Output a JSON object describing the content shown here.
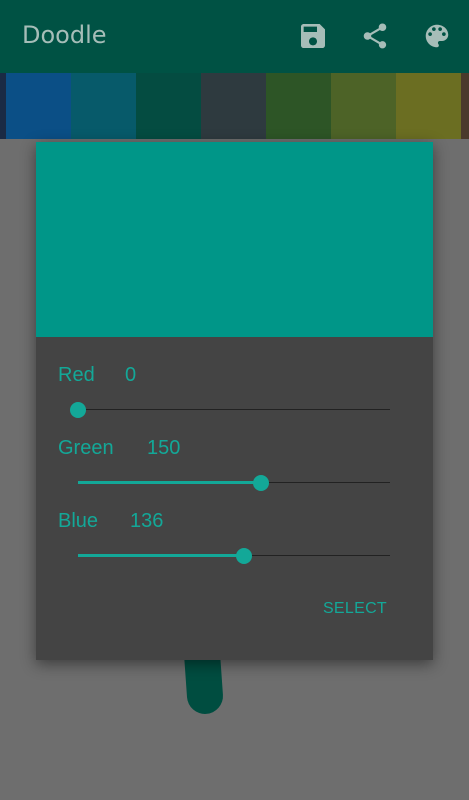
{
  "app": {
    "title": "Doodle",
    "actions": [
      {
        "name": "save-icon",
        "label": "Save"
      },
      {
        "name": "share-icon",
        "label": "Share"
      },
      {
        "name": "palette-icon",
        "label": "Palette"
      }
    ]
  },
  "palette": {
    "swatches": [
      "#0b4f86",
      "#075a6a",
      "#044c41",
      "#2e3a3f",
      "#2d5526",
      "#4d6327",
      "#6b6e22"
    ]
  },
  "dialog": {
    "preview_color": "#009688",
    "sliders": [
      {
        "label": "Red",
        "value": "0",
        "level": 0.0
      },
      {
        "label": "Green",
        "value": "150",
        "level": 0.588
      },
      {
        "label": "Blue",
        "value": "136",
        "level": 0.533
      }
    ],
    "select_label": "SELECT"
  },
  "colors": {
    "accent": "#13a898",
    "appbar": "#005244",
    "scrim": "#6e6e6e",
    "dialog_bg": "#444444"
  }
}
